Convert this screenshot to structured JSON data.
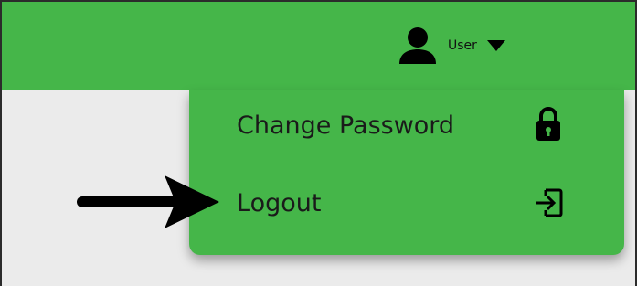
{
  "header": {
    "user_label": "User",
    "user_icon": "person-icon",
    "caret_icon": "caret-down-icon"
  },
  "dropdown": {
    "items": [
      {
        "label": "Change Password",
        "icon": "lock-icon"
      },
      {
        "label": "Logout",
        "icon": "logout-icon"
      }
    ]
  },
  "annotation": {
    "icon": "arrow-right-icon"
  },
  "colors": {
    "brand_green": "#45b649",
    "content_bg": "#ebebeb",
    "text": "#1a1a1a",
    "icon": "#000000"
  }
}
